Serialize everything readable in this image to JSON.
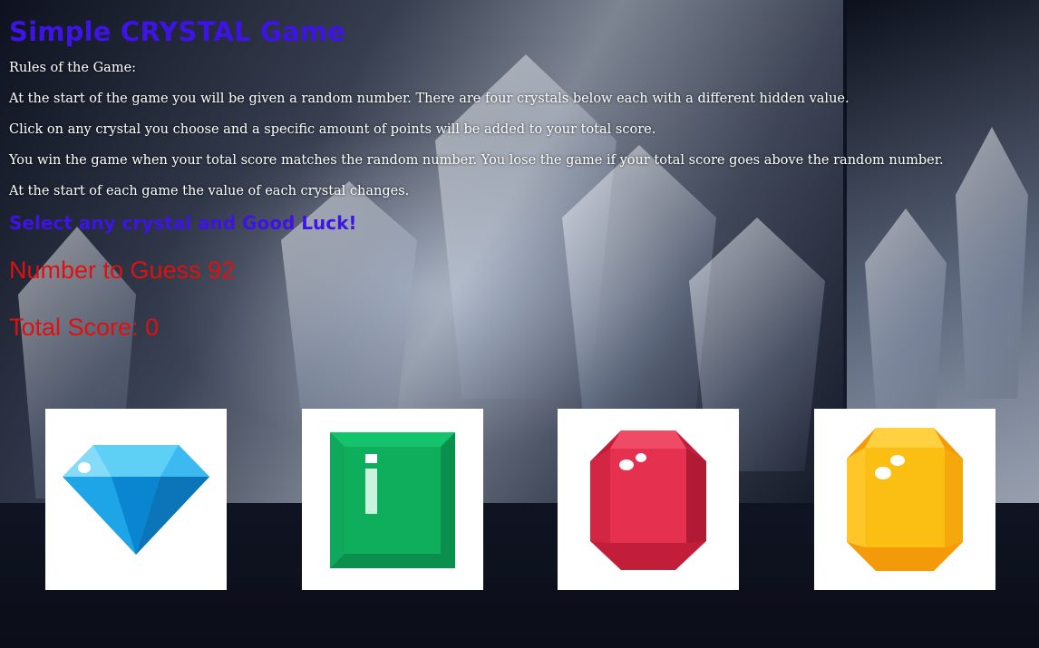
{
  "title": "Simple CRYSTAL Game",
  "rules": {
    "heading": "Rules of the Game:",
    "lines": [
      "At the start of the game you will be given a random number. There are four crystals below each with a different hidden value.",
      "Click on any crystal you choose and a specific amount of points will be added to your total score.",
      "You win the game when your total score matches the random number. You lose the game if your total score goes above the random number.",
      "At the start of each game the value of each crystal changes."
    ]
  },
  "prompt": "Select any crystal and Good Luck!",
  "number_to_guess": {
    "label": "Number to Guess",
    "value": "92"
  },
  "total_score": {
    "label": "Total Score:",
    "value": "0"
  },
  "crystals": [
    {
      "icon": "blue-diamond-icon",
      "color": "#1ea5e8"
    },
    {
      "icon": "green-emerald-icon",
      "color": "#0fae5c"
    },
    {
      "icon": "red-ruby-icon",
      "color": "#e5304f"
    },
    {
      "icon": "yellow-topaz-icon",
      "color": "#fbbe13"
    }
  ],
  "colors": {
    "heading": "#3d13e6",
    "stat": "#e0100f"
  }
}
